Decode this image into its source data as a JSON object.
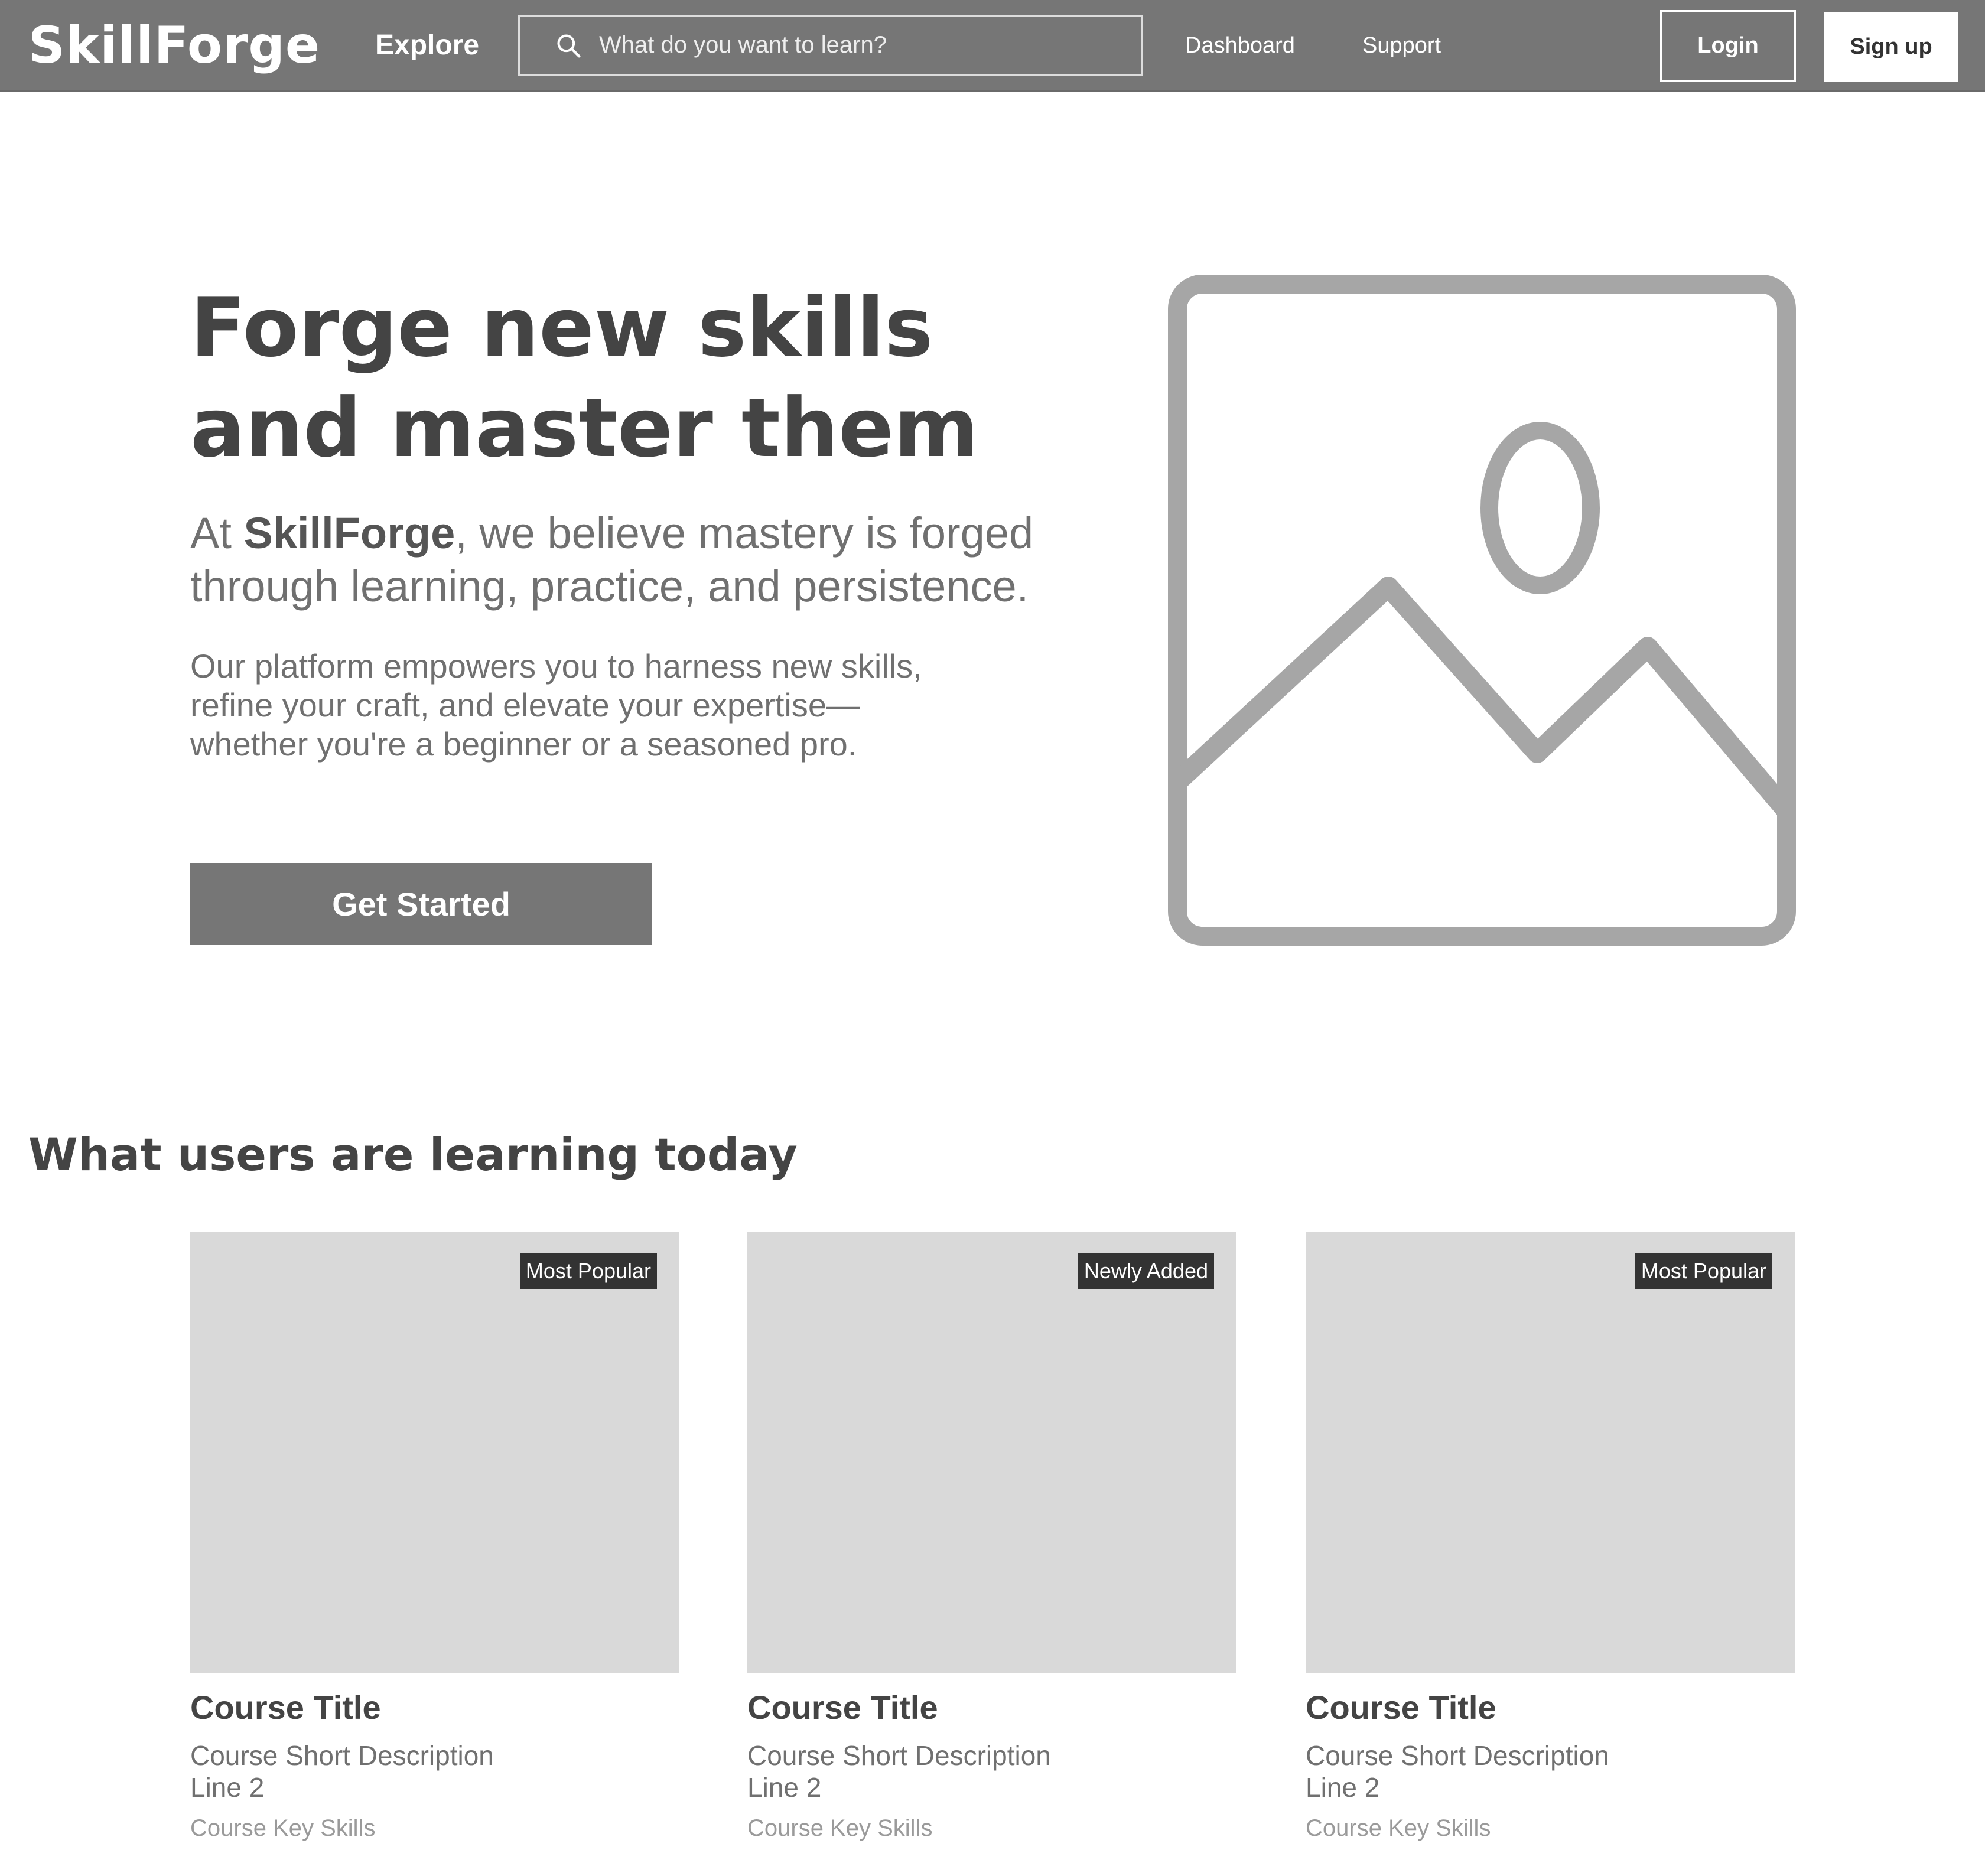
{
  "nav": {
    "logo": "SkillForge",
    "explore": "Explore",
    "search_placeholder": "What do you want to learn?",
    "dashboard": "Dashboard",
    "support": "Support",
    "login": "Login",
    "signup": "Sign up"
  },
  "hero": {
    "title": "Forge new skills and master them",
    "lead_prefix": "At ",
    "lead_brand": "SkillForge",
    "lead_suffix": ", we believe mastery is forged through learning, practice, and persistence.",
    "body": "Our platform empowers you to harness new skills,\nrefine your craft, and elevate your expertise—\nwhether you're a beginner or a seasoned pro.",
    "cta": "Get Started",
    "image_icon": "image-placeholder-icon"
  },
  "courses": {
    "title": "What users are learning today",
    "items": [
      {
        "badge": "Most Popular",
        "title": "Course Title",
        "desc": "Course Short Description\nLine 2",
        "skills": "Course Key Skills"
      },
      {
        "badge": "Newly Added",
        "title": "Course Title",
        "desc": "Course Short Description\nLine 2",
        "skills": "Course Key Skills"
      },
      {
        "badge": "Most Popular",
        "title": "Course Title",
        "desc": "Course Short Description\nLine 2",
        "skills": "Course Key Skills"
      }
    ]
  },
  "colors": {
    "nav_bg": "#767676",
    "card_thumb": "#d9d9d9",
    "badge_bg": "#333333",
    "cta_bg": "#767676",
    "icon_stroke": "#a6a6a6"
  }
}
